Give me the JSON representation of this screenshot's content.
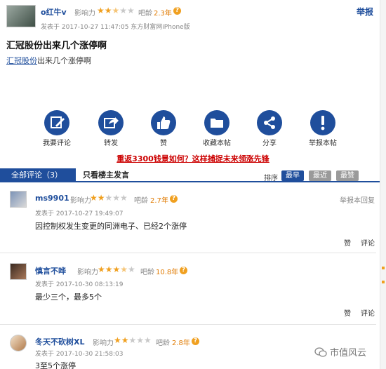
{
  "post": {
    "author": "o红牛v",
    "influence_label": "影响力",
    "influence_stars": 2.5,
    "age_label": "吧龄",
    "age": "2.3年",
    "report": "举报",
    "time": "发表于 2017-10-27 11:47:05 东方财富网iPhone版",
    "title": "汇冠股份出来几个涨停啊",
    "body_link": "汇冠股份",
    "body_rest": "出来几个涨停啊"
  },
  "actions": [
    {
      "label": "我要评论",
      "icon": "edit-icon"
    },
    {
      "label": "转发",
      "icon": "forward-icon"
    },
    {
      "label": "赞",
      "icon": "thumbs-up-icon"
    },
    {
      "label": "收藏本帖",
      "icon": "folder-icon"
    },
    {
      "label": "分享",
      "icon": "share-icon"
    },
    {
      "label": "举报本帖",
      "icon": "exclamation-icon"
    }
  ],
  "promo": "重返3300钱景如何？这样捕捉未来领涨先锋",
  "tabs": {
    "all": "全部评论（3）",
    "owner": "只看楼主发言",
    "sort_label": "排序",
    "sort": [
      "最早",
      "最近",
      "最赞"
    ]
  },
  "comments": [
    {
      "author": "ms9901",
      "influence_label": "影响力",
      "influence_stars": 2,
      "age_label": "吧龄",
      "age": "2.7年",
      "time": "发表于 2017-10-27 19:49:07",
      "text": "因控制权发生变更的同洲电子、已经2个涨停",
      "report": "举报本回复",
      "like": "赞",
      "reply": "评论"
    },
    {
      "author": "慎言不哗",
      "influence_label": "影响力",
      "influence_stars": 3.5,
      "age_label": "吧龄",
      "age": "10.8年",
      "time": "发表于 2017-10-30 08:13:19",
      "text": "最少三个，最多5个",
      "like": "赞",
      "reply": "评论"
    },
    {
      "author": "冬天不砍树XL",
      "influence_label": "影响力",
      "influence_stars": 2,
      "age_label": "吧龄",
      "age": "2.8年",
      "time": "发表于 2017-10-30 21:58:03",
      "text": "3至5个涨停"
    }
  ],
  "watermark": "市值风云",
  "colors": {
    "accent": "#1f4e9c",
    "star": "#f0a020",
    "promo": "#cc0000"
  }
}
